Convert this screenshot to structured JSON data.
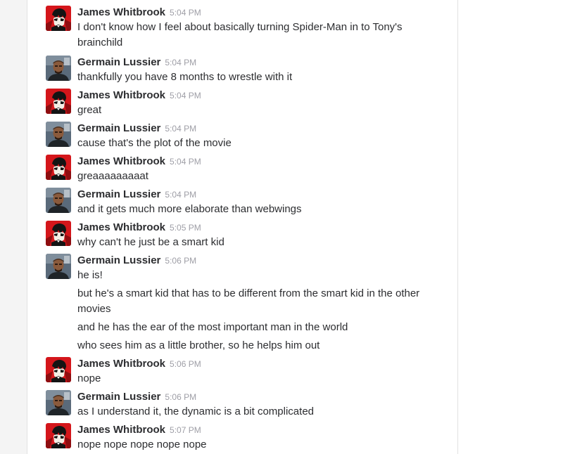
{
  "chat": {
    "messages": [
      {
        "author": "James Whitbrook",
        "time": "5:04 PM",
        "avatar": "persona-avatar",
        "lines": [
          "I don't know how I feel about basically turning Spider-Man in to Tony's brainchild"
        ]
      },
      {
        "author": "Germain Lussier",
        "time": "5:04 PM",
        "avatar": "photo-avatar",
        "lines": [
          "thankfully you have 8 months to wrestle with it"
        ]
      },
      {
        "author": "James Whitbrook",
        "time": "5:04 PM",
        "avatar": "persona-avatar",
        "lines": [
          "great"
        ]
      },
      {
        "author": "Germain Lussier",
        "time": "5:04 PM",
        "avatar": "photo-avatar",
        "lines": [
          "cause that's the plot of the movie"
        ]
      },
      {
        "author": "James Whitbrook",
        "time": "5:04 PM",
        "avatar": "persona-avatar",
        "lines": [
          "greaaaaaaaaat"
        ]
      },
      {
        "author": "Germain Lussier",
        "time": "5:04 PM",
        "avatar": "photo-avatar",
        "lines": [
          "and it gets much more elaborate than webwings"
        ]
      },
      {
        "author": "James Whitbrook",
        "time": "5:05 PM",
        "avatar": "persona-avatar",
        "lines": [
          "why can't he just be a smart kid"
        ]
      },
      {
        "author": "Germain Lussier",
        "time": "5:06 PM",
        "avatar": "photo-avatar",
        "lines": [
          "he is!",
          "but he's a smart kid that has to be different from the smart kid in the other movies",
          "and he has the ear of the most important man in the world",
          "who sees him as a little brother, so he helps him out"
        ]
      },
      {
        "author": "James Whitbrook",
        "time": "5:06 PM",
        "avatar": "persona-avatar",
        "lines": [
          "nope"
        ]
      },
      {
        "author": "Germain Lussier",
        "time": "5:06 PM",
        "avatar": "photo-avatar",
        "lines": [
          "as I understand it, the dynamic is a bit complicated"
        ]
      },
      {
        "author": "James Whitbrook",
        "time": "5:07 PM",
        "avatar": "persona-avatar",
        "lines": [
          "nope nope nope nope nope"
        ]
      }
    ]
  }
}
